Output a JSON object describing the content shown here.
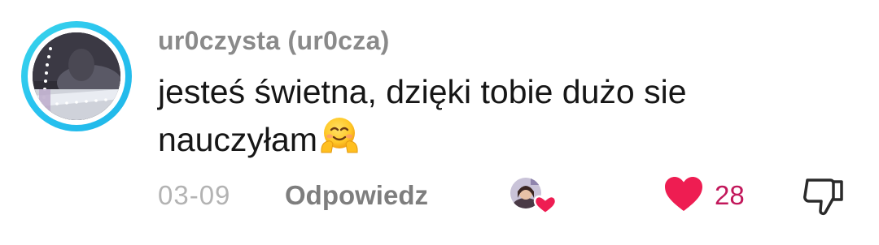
{
  "comment": {
    "username": "ur0czysta (ur0cza)",
    "text": "jesteś świetna, dzięki tobie dużo sie nauczyłam",
    "emoji": "hugging-face",
    "date": "03-09",
    "reply_label": "Odpowiedz",
    "likes": "28",
    "liked": true,
    "creator_liked": true
  },
  "colors": {
    "avatar_ring": "#29c3f0",
    "username": "#8a8a8a",
    "text": "#161616",
    "meta": "#b3b3b3",
    "reply": "#7e7e7e",
    "heart": "#ee1d52",
    "like_count": "#c2185b"
  },
  "icons": {
    "avatar": "user-avatar",
    "creator_liked": "creator-liked-badge",
    "like": "heart-icon",
    "dislike": "thumbs-down-icon"
  }
}
